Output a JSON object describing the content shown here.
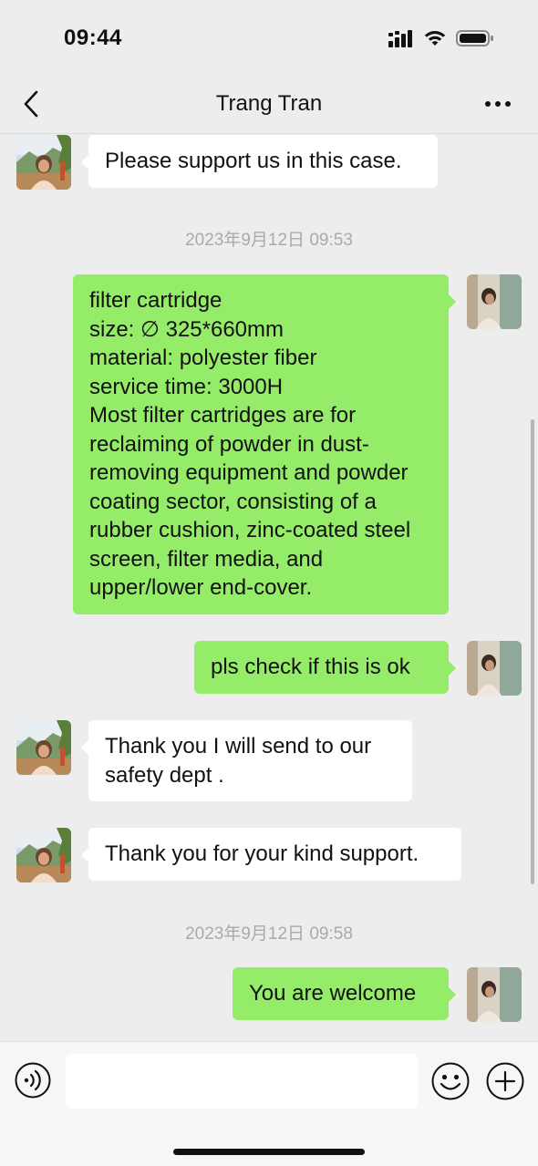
{
  "status_bar": {
    "time": "09:44",
    "icons": [
      "cellular-signal-icon",
      "wifi-icon",
      "battery-icon"
    ]
  },
  "nav": {
    "title": "Trang Tran",
    "back_icon": "chevron-left-icon",
    "more_icon": "more-icon"
  },
  "messages": [
    {
      "type": "incoming",
      "text": "Please support us in this case."
    },
    {
      "type": "timestamp",
      "text": "2023年9月12日 09:53"
    },
    {
      "type": "outgoing",
      "text": "filter cartridge\nsize: ∅ 325*660mm\nmaterial: polyester fiber\nservice time: 3000H\nMost filter cartridges are for reclaiming of powder in dust-removing equipment and powder  coating sector, consisting of a rubber cushion, zinc-coated steel screen, filter media, and upper/lower end-cover."
    },
    {
      "type": "outgoing",
      "text": "pls check if this is ok"
    },
    {
      "type": "incoming",
      "text": "Thank you I will send to our safety dept ."
    },
    {
      "type": "incoming",
      "text": "Thank you for your kind support."
    },
    {
      "type": "timestamp",
      "text": "2023年9月12日 09:58"
    },
    {
      "type": "outgoing",
      "text": "You are welcome"
    }
  ],
  "input_bar": {
    "value": "",
    "placeholder": "",
    "voice_icon": "voice-icon",
    "emoji_icon": "emoji-icon",
    "plus_icon": "plus-icon"
  },
  "colors": {
    "background": "#ededed",
    "outgoing_bubble": "#95ec69",
    "incoming_bubble": "#ffffff",
    "timestamp_text": "#aaaaaa"
  }
}
